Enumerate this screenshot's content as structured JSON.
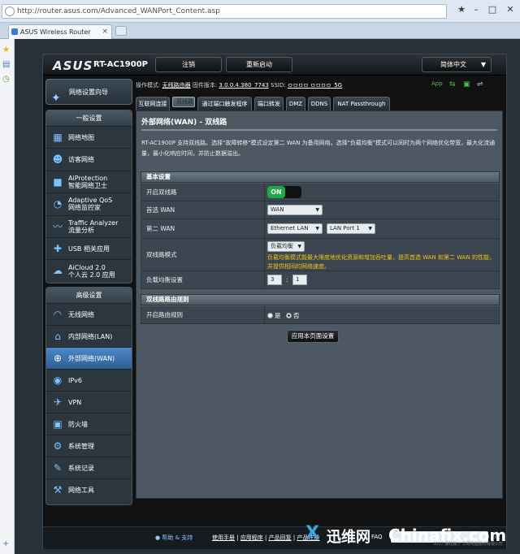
{
  "browser": {
    "url": "http://router.asus.com/Advanced_WANPort_Content.asp",
    "tab_title": "ASUS Wireless Router"
  },
  "router": {
    "brand": "ASUS",
    "model": "RT-AC1900P",
    "logout_label": "注销",
    "reboot_label": "重新启动",
    "language": "简体中文"
  },
  "status": {
    "mode_label": "操作模式:",
    "mode_value": "无线路由器",
    "fw_label": "固件版本:",
    "fw_value": "3.0.0.4.380_7743",
    "ssid_label": "SSID:",
    "ssid_value": "ㅁㅁㅁㅁ  ㅁㅁㅁㅁ_5G",
    "app_label": "App"
  },
  "sidebar": {
    "wizard": "网络设置向导",
    "general_title": "一般设置",
    "general": [
      {
        "label": "网络地图",
        "icon": "network-map-icon"
      },
      {
        "label": "访客网络",
        "icon": "guest-network-icon"
      },
      {
        "label": "AiProtection",
        "sub": "智能网络卫士",
        "icon": "lock-icon"
      },
      {
        "label": "Adaptive QoS",
        "sub": "网络监控家",
        "icon": "speedometer-icon"
      },
      {
        "label": "Traffic Analyzer",
        "sub": "流量分析",
        "icon": "traffic-chart-icon"
      },
      {
        "label": "USB 相关应用",
        "icon": "puzzle-icon"
      },
      {
        "label": "AiCloud 2.0",
        "sub": "个人云 2.0 应用",
        "icon": "cloud-icon"
      }
    ],
    "advanced_title": "高级设置",
    "advanced": [
      {
        "label": "无线网络",
        "icon": "wifi-icon"
      },
      {
        "label": "内部网络(LAN)",
        "icon": "home-icon"
      },
      {
        "label": "外部网络(WAN)",
        "icon": "globe-icon",
        "active": true
      },
      {
        "label": "IPv6",
        "icon": "ipv6-icon"
      },
      {
        "label": "VPN",
        "icon": "vpn-icon"
      },
      {
        "label": "防火墙",
        "icon": "firewall-icon"
      },
      {
        "label": "系统管理",
        "icon": "admin-icon"
      },
      {
        "label": "系统记录",
        "icon": "log-icon"
      },
      {
        "label": "网络工具",
        "icon": "tools-icon"
      }
    ]
  },
  "tabs": [
    "互联网连接",
    "双线路",
    "通过端口触发程序",
    "端口转发",
    "DMZ",
    "DDNS",
    "NAT Passthrough"
  ],
  "panel": {
    "title": "外部网络(WAN) - 双线路",
    "description": "RT-AC1900P 支持双线路。选择\"故障转移\"模式设定第二 WAN 为备用网络。选择\"负载均衡\"模式可以同时为两个网络优化带宽，最大化流通量，最小化响应时间，并防止数据溢出。",
    "basic_section": "基本设置",
    "enable_label": "开启双线路",
    "enable_value": "ON",
    "primary_label": "首选 WAN",
    "primary_value": "WAN",
    "secondary_label": "第二 WAN",
    "secondary_value": "Ethernet LAN",
    "secondary_port": "LAN Port 1",
    "mode_label": "双线路模式",
    "mode_value": "负载均衡",
    "mode_hint": "负载均衡模式能最大限度地优化资源和增加吞吐量，提高首选 WAN 和第二 WAN 的性能，并提供相同的网络速度。",
    "lb_label": "负载均衡设置",
    "lb_value_1": "3",
    "lb_sep": ":",
    "lb_value_2": "1",
    "routing_section": "双线路路由规则",
    "routing_label": "开启路由规则",
    "routing_yes": "是",
    "routing_no": "否",
    "apply_label": "应用本页面设置"
  },
  "footer": {
    "help": "帮助 & 支持",
    "link1": "使用手册",
    "link2": "应用程序",
    "link3": "产品回复",
    "link4": "产品注册",
    "faq": "FAQ",
    "copyright": "2017 版权属于 华硕电脑股份有限公司"
  },
  "watermark": {
    "cn": "迅维网",
    "en": "Chinafix.com"
  }
}
